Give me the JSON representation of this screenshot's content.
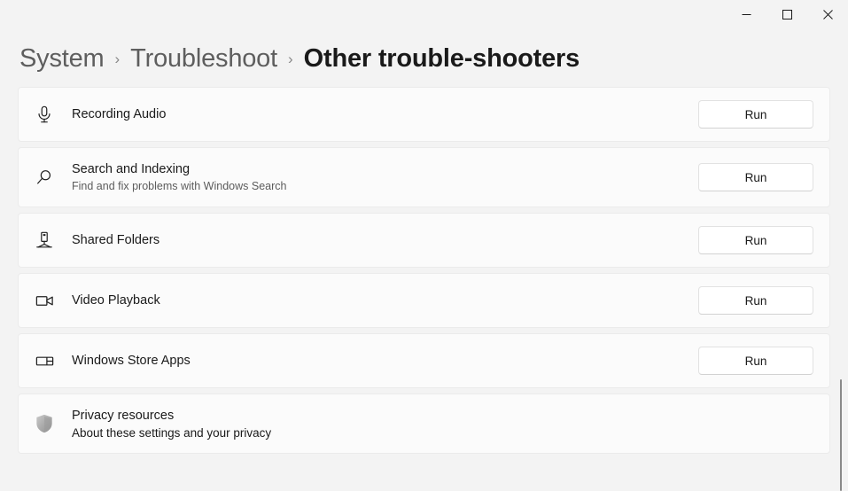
{
  "window": {
    "controls": [
      {
        "name": "minimize",
        "label": "Minimize"
      },
      {
        "name": "maximize",
        "label": "Maximize"
      },
      {
        "name": "close",
        "label": "Close"
      }
    ]
  },
  "breadcrumb": {
    "separator": "›",
    "items": [
      {
        "label": "System",
        "current": false
      },
      {
        "label": "Troubleshoot",
        "current": false
      },
      {
        "label": "Other trouble-shooters",
        "current": true
      }
    ]
  },
  "troubleshooters": [
    {
      "icon": "microphone-icon",
      "title": "Recording Audio",
      "subtitle": "",
      "action": "Run"
    },
    {
      "icon": "search-icon",
      "title": "Search and Indexing",
      "subtitle": "Find and fix problems with Windows Search",
      "action": "Run"
    },
    {
      "icon": "shared-folders-icon",
      "title": "Shared Folders",
      "subtitle": "",
      "action": "Run"
    },
    {
      "icon": "video-camera-icon",
      "title": "Video Playback",
      "subtitle": "",
      "action": "Run"
    },
    {
      "icon": "store-apps-icon",
      "title": "Windows Store Apps",
      "subtitle": "",
      "action": "Run"
    }
  ],
  "privacy": {
    "icon": "shield-icon",
    "title": "Privacy resources",
    "link": "About these settings and your privacy"
  },
  "colors": {
    "page_background": "#f3f3f3",
    "card_background": "#fbfbfb",
    "card_border": "#ebebeb",
    "text_primary": "#1a1a1a",
    "text_secondary": "#5c5c5c",
    "breadcrumb_inactive": "#5e5e5e",
    "scrollbar_thumb": "#8a8a8a"
  }
}
